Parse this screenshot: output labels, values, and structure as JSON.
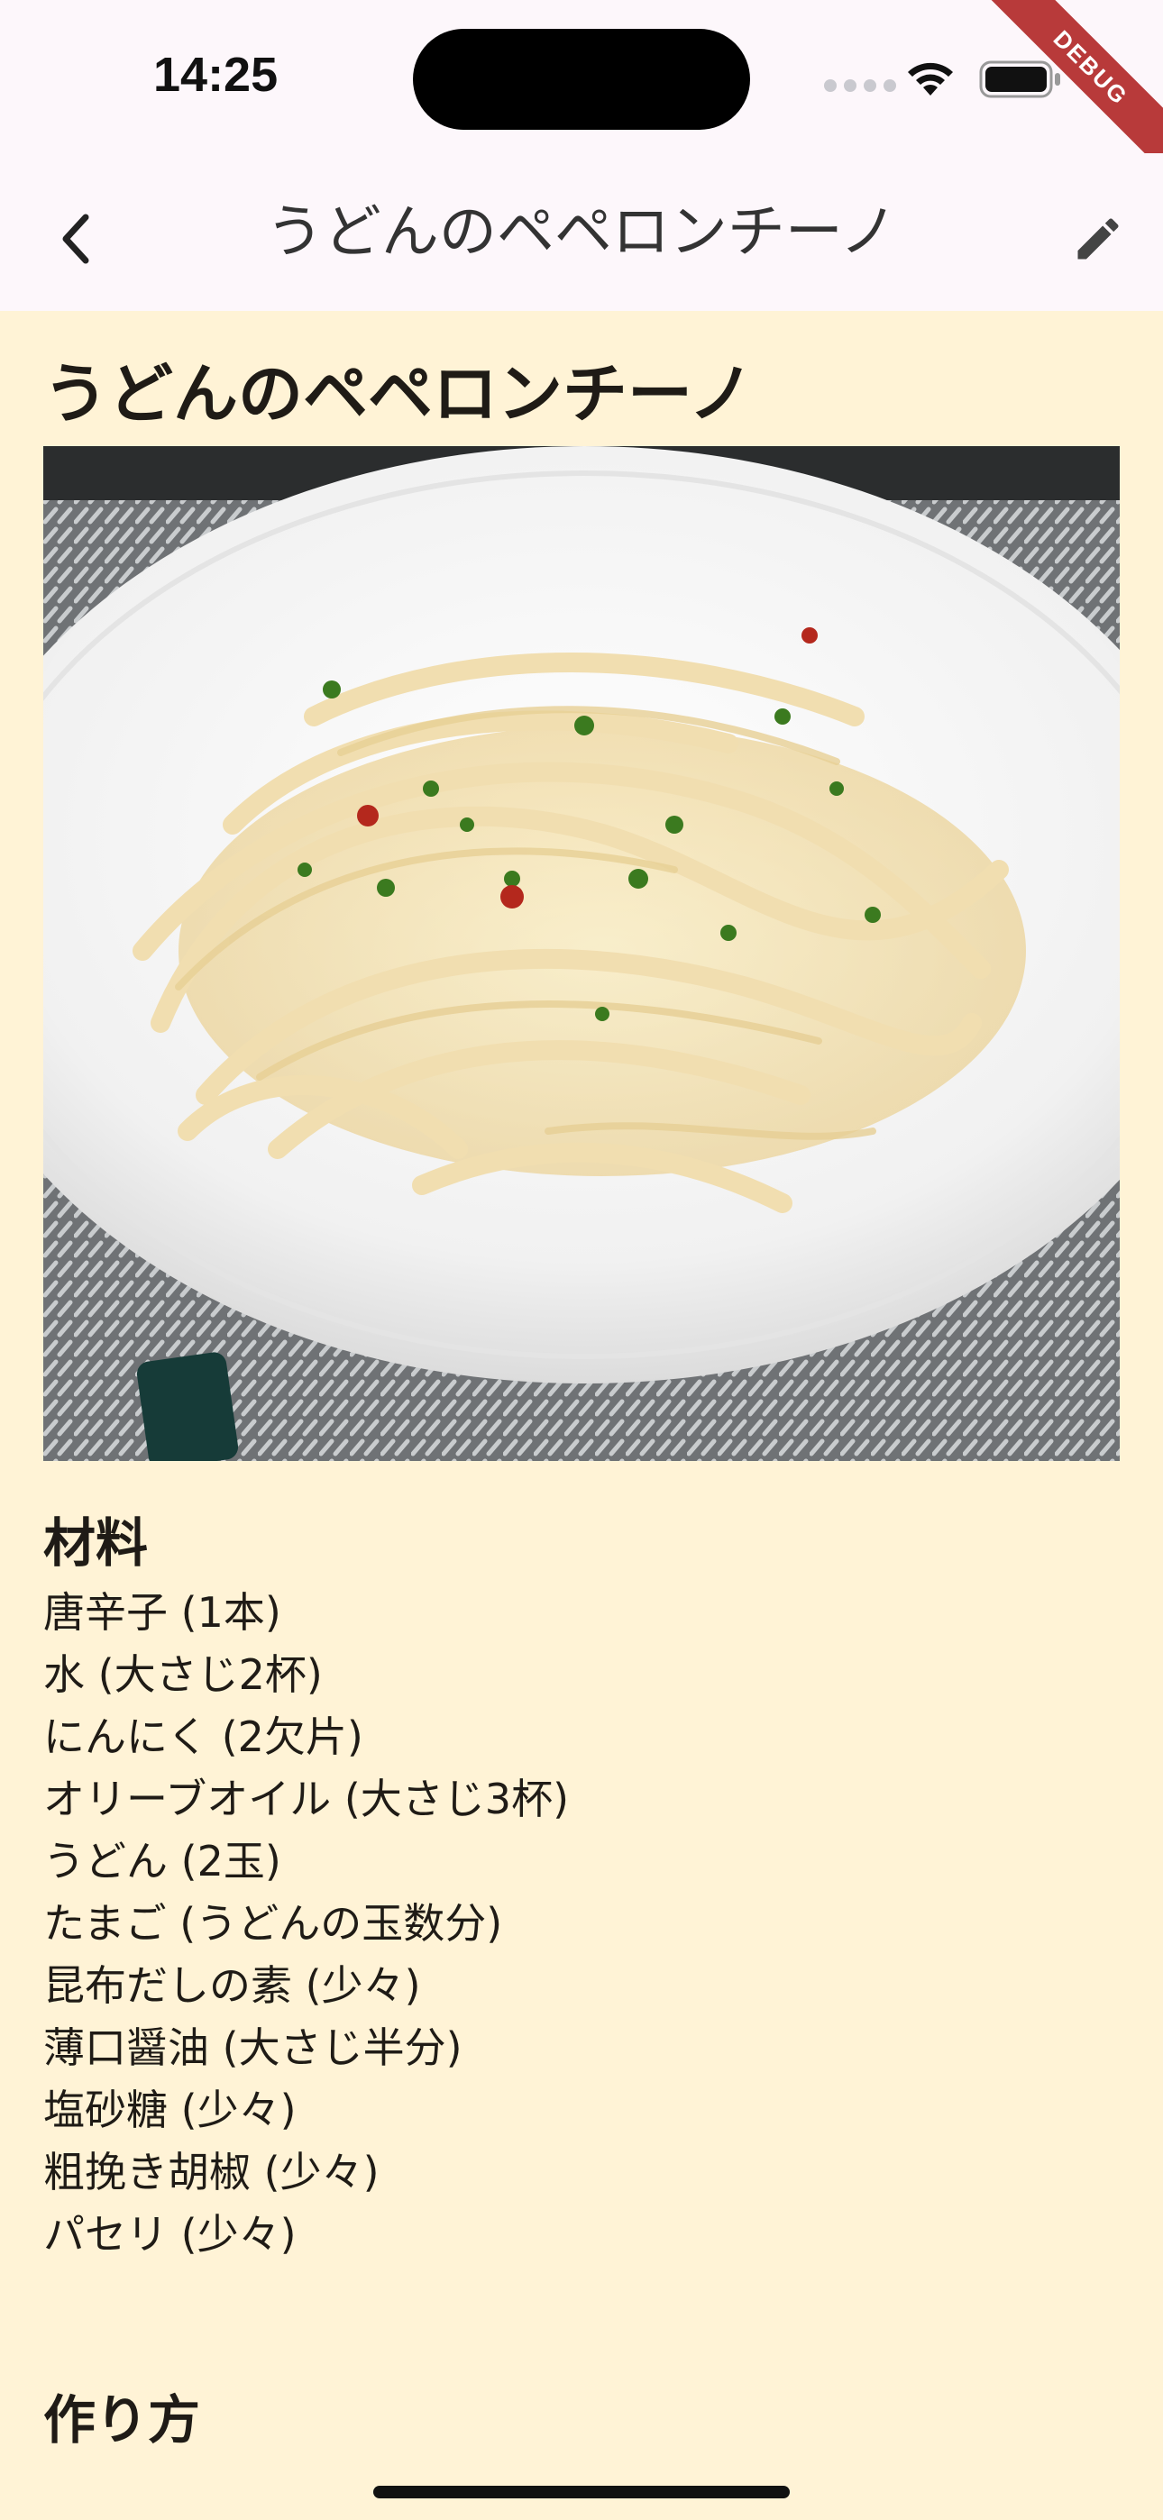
{
  "status_bar": {
    "time": "14:25",
    "debug_label": "DEBUG"
  },
  "app_bar": {
    "title": "うどんのペペロンチーノ",
    "back_icon": "chevron-left-icon",
    "edit_icon": "pencil-icon"
  },
  "recipe": {
    "title": "うどんのペペロンチーノ",
    "ingredients_heading": "材料",
    "ingredients": [
      "唐辛子 (1本)",
      "水 (大さじ2杯)",
      "にんにく (2欠片)",
      "オリーブオイル (大さじ3杯)",
      "うどん (2玉)",
      "たまご (うどんの玉数分)",
      "昆布だしの素 (少々)",
      "薄口醤油 (大さじ半分)",
      "塩砂糖 (少々)",
      "粗挽き胡椒 (少々)",
      "パセリ (少々)"
    ],
    "steps_heading": "作り方"
  },
  "colors": {
    "background": "#fff3d6",
    "app_bar": "#fdf7fb",
    "debug_banner": "#b83a3a"
  }
}
